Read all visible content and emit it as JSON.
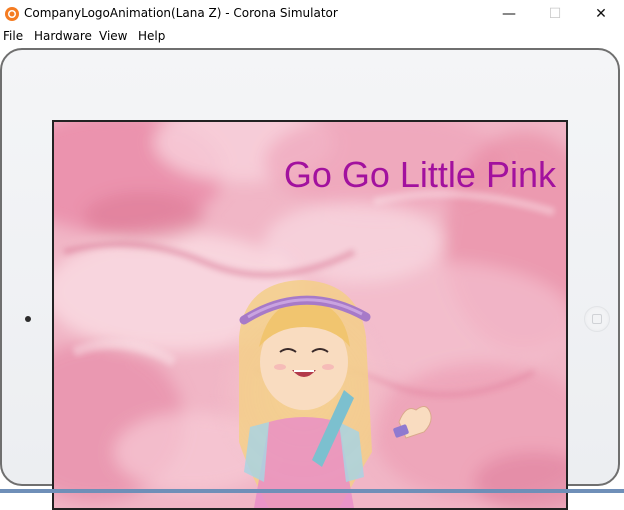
{
  "window": {
    "title": "CompanyLogoAnimation(Lana Z) - Corona Simulator",
    "app_icon": "corona-icon",
    "controls": {
      "minimize": "—",
      "maximize": "☐",
      "close": "✕"
    }
  },
  "menu": [
    "File",
    "Hardware",
    "View",
    "Help"
  ],
  "device": {
    "type": "tablet",
    "frame_color": "#eceef1",
    "border_color": "#6f6f6f"
  },
  "screen": {
    "title": "Go Go Little Pink",
    "title_color": "#a2119e",
    "background": "pink watercolor",
    "character": "girl-with-headband-illustration"
  }
}
